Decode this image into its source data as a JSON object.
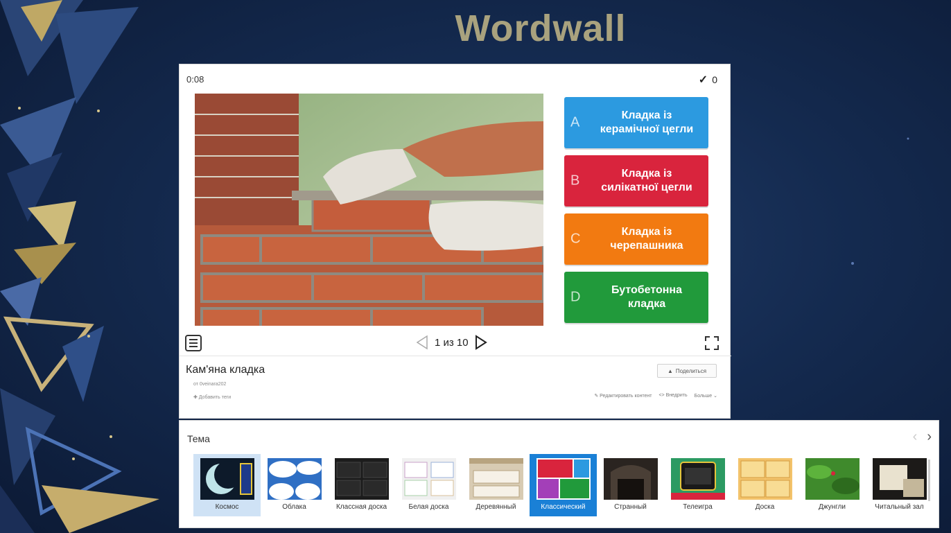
{
  "slide": {
    "title": "Wordwall"
  },
  "activity": {
    "timer": "0:08",
    "score": "0",
    "question_image": "brick-laying-photo",
    "answers": [
      {
        "letter": "A",
        "text": "Кладка із керамічної цегли",
        "color": "#2c9ae0"
      },
      {
        "letter": "B",
        "text": "Кладка із силікатної цегли",
        "color": "#d9243d"
      },
      {
        "letter": "C",
        "text": "Кладка із черепашника",
        "color": "#f27a11"
      },
      {
        "letter": "D",
        "text": "Бутобетонна кладка",
        "color": "#219a3b"
      }
    ],
    "pager": "1 из 10",
    "title": "Кам'яна кладка",
    "author": "от  0veinara202",
    "add_tags": "✚ Добавить теги",
    "share_label": "Поделиться",
    "actions": {
      "edit": "✎ Редактировать контент",
      "embed": "<> Внедрить",
      "more": "Больше ⌄"
    }
  },
  "themes": {
    "title": "Тема",
    "items": [
      {
        "label": "Космос",
        "state": "selected"
      },
      {
        "label": "Облака",
        "state": "normal"
      },
      {
        "label": "Классная доска",
        "state": "normal"
      },
      {
        "label": "Белая доска",
        "state": "normal"
      },
      {
        "label": "Деревянный",
        "state": "normal"
      },
      {
        "label": "Классический",
        "state": "current"
      },
      {
        "label": "Странный",
        "state": "normal"
      },
      {
        "label": "Телеигра",
        "state": "normal"
      },
      {
        "label": "Доска",
        "state": "normal"
      },
      {
        "label": "Джунгли",
        "state": "normal"
      },
      {
        "label": "Читальный зал",
        "state": "normal"
      }
    ]
  }
}
